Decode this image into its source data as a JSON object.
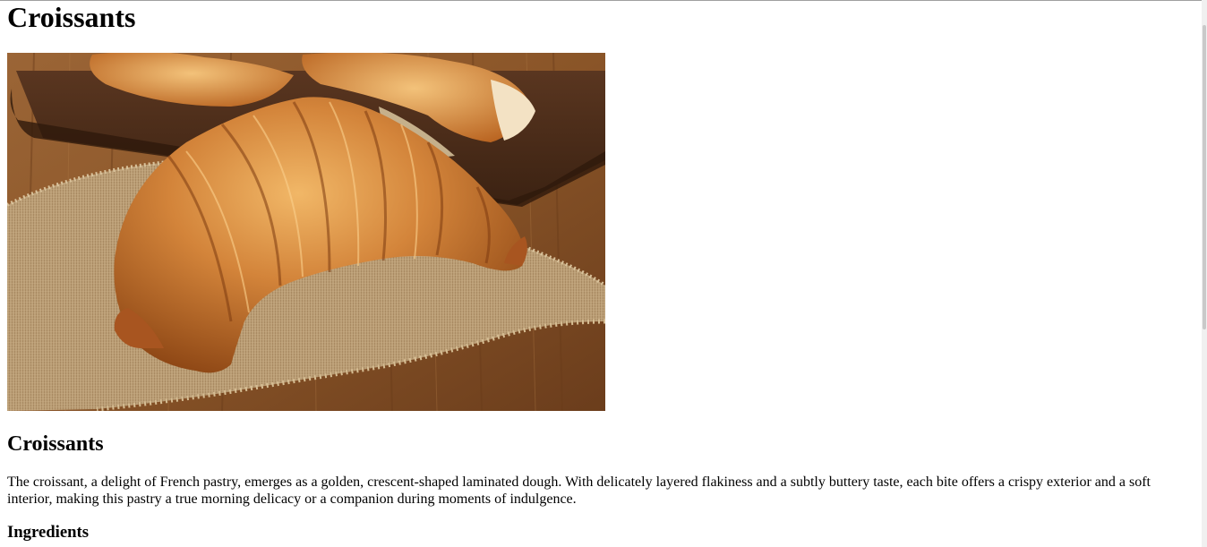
{
  "page": {
    "title": "Croissants"
  },
  "image": {
    "alt": "Croissants"
  },
  "section": {
    "heading": "Croissants",
    "description": "The croissant, a delight of French pastry, emerges as a golden, crescent-shaped laminated dough. With delicately layered flakiness and a subtly buttery taste, each bite offers a crispy exterior and a soft interior, making this pastry a true morning delicacy or a companion during moments of indulgence.",
    "subheading": "Ingredients"
  },
  "colors": {
    "wood": "#8a5a30",
    "board": "#4e2f19",
    "burlap": "#b9996e",
    "crust": "#c4772f"
  }
}
